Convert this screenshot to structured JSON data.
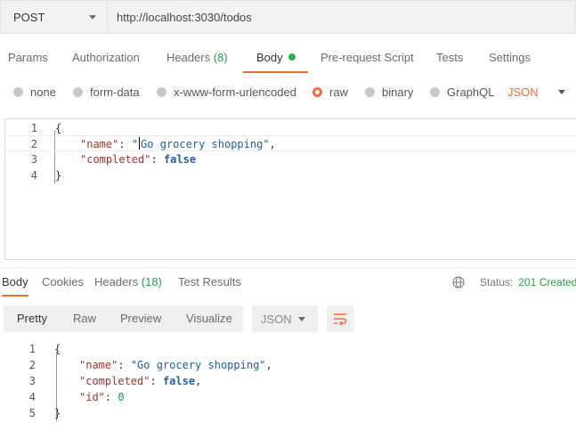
{
  "request": {
    "method": "POST",
    "url": "http://localhost:3030/todos"
  },
  "request_tabs": [
    {
      "label": "Params",
      "count": "",
      "active": false
    },
    {
      "label": "Authorization",
      "count": "",
      "active": false
    },
    {
      "label": "Headers",
      "count": "(8)",
      "active": false
    },
    {
      "label": "Body",
      "count": "",
      "active": true
    },
    {
      "label": "Pre-request Script",
      "count": "",
      "active": false
    },
    {
      "label": "Tests",
      "count": "",
      "active": false
    },
    {
      "label": "Settings",
      "count": "",
      "active": false
    }
  ],
  "body_types": [
    {
      "label": "none",
      "selected": false
    },
    {
      "label": "form-data",
      "selected": false
    },
    {
      "label": "x-www-form-urlencoded",
      "selected": false
    },
    {
      "label": "raw",
      "selected": true
    },
    {
      "label": "binary",
      "selected": false
    },
    {
      "label": "GraphQL",
      "selected": false
    }
  ],
  "raw_language": "JSON",
  "request_body": {
    "line_numbers": [
      "1",
      "2",
      "3",
      "4"
    ],
    "open_brace": "{",
    "close_brace": "}",
    "name_key": "\"name\"",
    "name_value_open": "\"",
    "name_value_rest": "Go grocery shopping\"",
    "completed_key": "\"completed\"",
    "completed_value": "false",
    "colon": ": ",
    "comma": ","
  },
  "response_tabs": [
    {
      "label": "Body",
      "count": "",
      "active": true
    },
    {
      "label": "Cookies",
      "count": "",
      "active": false
    },
    {
      "label": "Headers",
      "count": "(18)",
      "active": false
    },
    {
      "label": "Test Results",
      "count": "",
      "active": false
    }
  ],
  "status": {
    "label": "Status:",
    "value": "201 Created"
  },
  "view_modes": [
    {
      "label": "Pretty",
      "active": true
    },
    {
      "label": "Raw",
      "active": false
    },
    {
      "label": "Preview",
      "active": false
    },
    {
      "label": "Visualize",
      "active": false
    }
  ],
  "response_format": "JSON",
  "response_body": {
    "line_numbers": [
      "1",
      "2",
      "3",
      "4",
      "5"
    ],
    "open_brace": "{",
    "close_brace": "}",
    "name_key": "\"name\"",
    "name_value": "\"Go grocery shopping\"",
    "completed_key": "\"completed\"",
    "completed_value": "false",
    "id_key": "\"id\"",
    "id_value": "0",
    "colon": ": ",
    "comma": ","
  },
  "colors": {
    "accent": "#f26b3a",
    "success": "#2a9d48",
    "json_key": "#a3332c",
    "json_value": "#1f5fa6"
  }
}
